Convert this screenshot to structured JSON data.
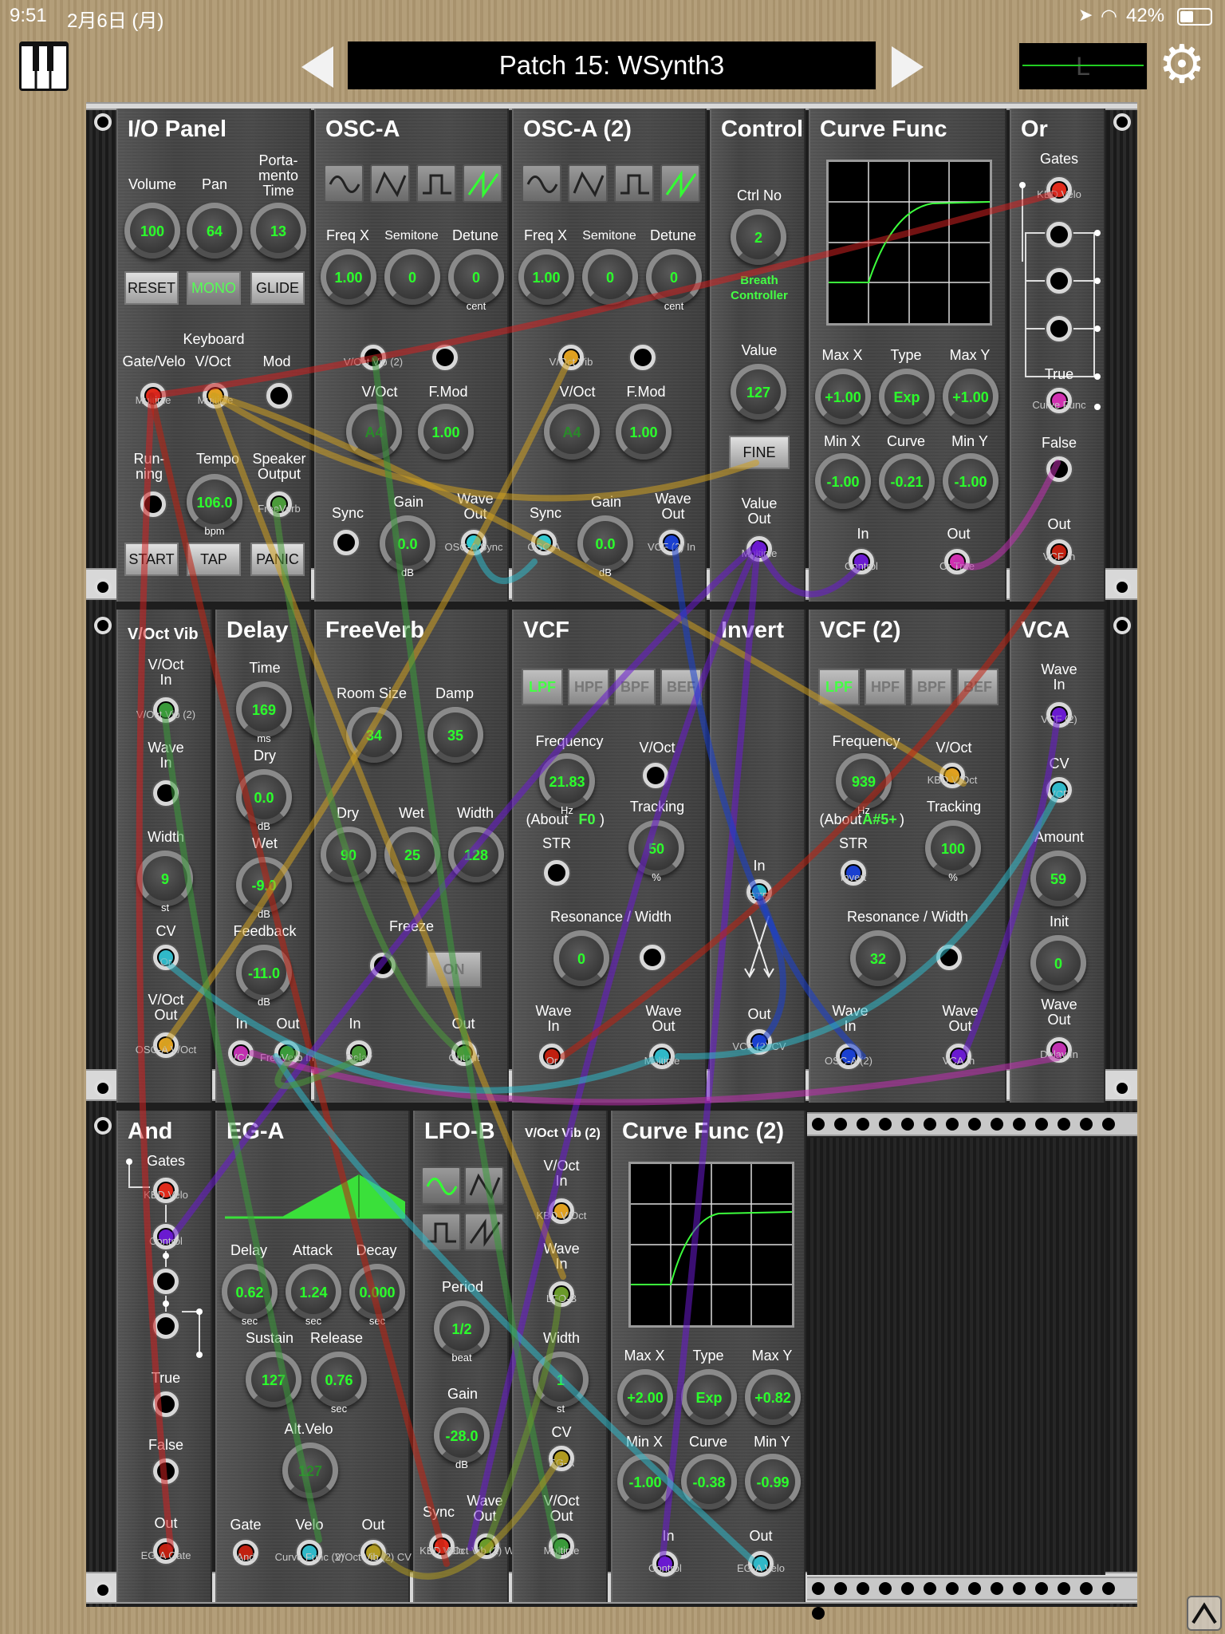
{
  "status": {
    "time": "9:51",
    "date": "2月6日 (月)",
    "battery": "42%"
  },
  "header": {
    "patch_title": "Patch 15: WSynth3",
    "meter_text": "L",
    "piano_icon": "piano-keyboard-icon",
    "settings_icon": "gear-icon",
    "prev_icon": "left-triangle-icon",
    "next_icon": "right-triangle-icon"
  },
  "colors": {
    "wood": "#b09a74",
    "panel": "#4a4a4a",
    "knob_value": "#2bff2b",
    "screen_curve": "#3cff3c"
  },
  "modules": {
    "io": {
      "title": "I/O Panel",
      "volume": "Volume",
      "pan": "Pan",
      "porta": "Porta-\nmento\nTime",
      "volume_v": "100",
      "pan_v": "64",
      "porta_v": "13",
      "reset": "RESET",
      "mono": "MONO",
      "glide": "GLIDE",
      "keyboard": "Keyboard",
      "gatevelo": "Gate/Velo",
      "voct": "V/Oct",
      "mod": "Mod",
      "gatevelo_j": "Multiple",
      "voct_j": "Multiple",
      "running": "Run-\nning",
      "tempo": "Tempo",
      "tempo_v": "106.0",
      "tempo_u": "bpm",
      "speaker": "Speaker\nOutput",
      "speaker_j": "FreeVerb",
      "start": "START",
      "tap": "TAP",
      "panic": "PANIC"
    },
    "osca": {
      "title": "OSC-A",
      "freqx": "Freq X",
      "semitone": "Semitone",
      "detune": "Detune",
      "freqx_v": "1.00",
      "semitone_v": "0",
      "detune_v": "0",
      "detune_u": "cent",
      "vibjack": "V/Oct Vib (2)",
      "voct": "V/Oct",
      "fmod": "F.Mod",
      "voct_v": "A4",
      "fmod_v": "1.00",
      "sync": "Sync",
      "gain": "Gain",
      "gain_v": "0.0",
      "gain_u": "dB",
      "waveout": "Wave\nOut",
      "waveout_j": "OSC-A Sync"
    },
    "osca2": {
      "title": "OSC-A (2)",
      "freqx": "Freq X",
      "semitone": "Semitone",
      "detune": "Detune",
      "freqx_v": "1.00",
      "semitone_v": "0",
      "detune_v": "0",
      "detune_u": "cent",
      "vibjack": "V/Oct Vib",
      "voct": "V/Oct",
      "fmod": "F.Mod",
      "voct_v": "A4",
      "fmod_v": "1.00",
      "sync": "Sync",
      "sync_j": "OSC-A",
      "gain": "Gain",
      "gain_v": "0.0",
      "gain_u": "dB",
      "waveout": "Wave\nOut",
      "waveout_j": "VCF (2) In"
    },
    "control": {
      "title": "Control",
      "ctrlno": "Ctrl No",
      "ctrlno_v": "2",
      "ctrlno_desc": "Breath\nController",
      "value": "Value",
      "value_v": "127",
      "fine": "FINE",
      "valueout": "Value\nOut",
      "valueout_j": "Multiple"
    },
    "curve": {
      "title": "Curve Func",
      "maxx": "Max X",
      "type": "Type",
      "maxy": "Max Y",
      "maxx_v": "+1.00",
      "type_v": "Exp",
      "maxy_v": "+1.00",
      "minx": "Min X",
      "curve": "Curve",
      "miny": "Min Y",
      "minx_v": "-1.00",
      "curve_v": "-0.21",
      "miny_v": "-1.00",
      "in": "In",
      "in_j": "Control",
      "out": "Out",
      "out_j": "Or True"
    },
    "or": {
      "title": "Or",
      "gates": "Gates",
      "gate1_j": "KBD Velo",
      "true": "True",
      "true_j": "Curve Func",
      "false": "False",
      "out": "Out",
      "out_j": "VCF In"
    },
    "voctvib": {
      "title": "V/Oct Vib",
      "voctin": "V/Oct\nIn",
      "voctin_j": "V/Oct Vib (2)",
      "wavein": "Wave\nIn",
      "width": "Width",
      "width_v": "9",
      "width_u": "st",
      "cv": "CV",
      "cv_j": "Or",
      "voctout": "V/Oct\nOut",
      "voctout_j": "OSC-A V/Oct"
    },
    "delay": {
      "title": "Delay",
      "time": "Time",
      "time_v": "169",
      "time_u": "ms",
      "dry": "Dry",
      "dry_v": "0.0",
      "dry_u": "dB",
      "wet": "Wet",
      "wet_v": "-9.0",
      "wet_u": "dB",
      "feedback": "Feedback",
      "feedback_v": "-11.0",
      "feedback_u": "dB",
      "in": "In",
      "in_j": "VCA",
      "out": "Out",
      "out_j": "FreeVerb In"
    },
    "freeverb": {
      "title": "FreeVerb",
      "roomsize": "Room Size",
      "damp": "Damp",
      "roomsize_v": "34",
      "damp_v": "35",
      "dry": "Dry",
      "wet": "Wet",
      "width": "Width",
      "dry_v": "90",
      "wet_v": "25",
      "width_v": "128",
      "freeze": "Freeze",
      "on": "ON",
      "in": "In",
      "in_j": "Delay",
      "out": "Out",
      "out_j": "Output"
    },
    "vcf": {
      "title": "VCF",
      "lpf": "LPF",
      "hpf": "HPF",
      "bpf": "BPF",
      "bef": "BEF",
      "frequency": "Frequency",
      "freq_v": "21.83",
      "freq_u": "Hz",
      "about": "(About",
      "note": "F0",
      "about_end": ")",
      "voct": "V/Oct",
      "tracking": "Tracking",
      "tracking_v": "50",
      "tracking_u": "%",
      "str": "STR",
      "reswidth": "Resonance / Width",
      "res_v": "0",
      "wavein": "Wave\nIn",
      "wavein_j": "Or",
      "waveout": "Wave\nOut",
      "waveout_j": "Multiple"
    },
    "invert": {
      "title": "Invert",
      "in": "In",
      "in_j": "STR",
      "out": "Out",
      "out_j": "VCF (2) CV"
    },
    "vcf2": {
      "title": "VCF (2)",
      "lpf": "LPF",
      "hpf": "HPF",
      "bpf": "BPF",
      "bef": "BEF",
      "frequency": "Frequency",
      "freq_v": "939",
      "freq_u": "Hz",
      "about": "(About",
      "note": "A#5+",
      "about_end": ")",
      "voct": "V/Oct",
      "voct_j": "KBD V/Oct",
      "tracking": "Tracking",
      "tracking_v": "100",
      "tracking_u": "%",
      "str": "STR",
      "str_j": "Invert",
      "reswidth": "Resonance / Width",
      "res_v": "32",
      "wavein": "Wave\nIn",
      "wavein_j": "OSC-A (2)",
      "waveout": "Wave\nOut",
      "waveout_j": "VCA In"
    },
    "vca": {
      "title": "VCA",
      "wavein": "Wave\nIn",
      "wavein_j": "VCF (2)",
      "cv": "CV",
      "cv_j": "VCF",
      "amount": "Amount",
      "amount_v": "59",
      "init": "Init",
      "init_v": "0",
      "waveout": "Wave\nOut",
      "waveout_j": "Delay In"
    },
    "and": {
      "title": "And",
      "gates": "Gates",
      "g1_j": "KBD Velo",
      "g2_j": "Control",
      "true": "True",
      "false": "False",
      "out": "Out",
      "out_j": "EG-A Gate"
    },
    "ega": {
      "title": "EG-A",
      "delay": "Delay",
      "attack": "Attack",
      "decay": "Decay",
      "delay_v": "0.62",
      "attack_v": "1.24",
      "decay_v": "0.000",
      "u": "sec",
      "sustain": "Sustain",
      "release": "Release",
      "sustain_v": "127",
      "release_v": "0.76",
      "altvelo": "Alt.Velo",
      "altvelo_v": "127",
      "gate": "Gate",
      "gate_j": "And",
      "velo": "Velo",
      "velo_j": "Curve Func (2)",
      "out": "Out",
      "out_j": "V/Oct Vib (2) CV"
    },
    "lfob": {
      "title": "LFO-B",
      "period": "Period",
      "period_v": "1/2",
      "period_u": "beat",
      "gain": "Gain",
      "gain_v": "-28.0",
      "gain_u": "dB",
      "sync": "Sync",
      "sync_j": "KBD Velo",
      "waveout": "Wave\nOut",
      "waveout_j": "V/Oct Vib (2) Wave In"
    },
    "voctvib2": {
      "title": "V/Oct Vib (2)",
      "voctin": "V/Oct\nIn",
      "voctin_j": "KBD V/Oct",
      "wavein": "Wave\nIn",
      "wavein_j": "LFO-B",
      "width": "Width",
      "width_v": "1",
      "width_u": "st",
      "cv": "CV",
      "cv_j": "EG-A",
      "voctout": "V/Oct\nOut",
      "voctout_j": "Multiple"
    },
    "curve2": {
      "title": "Curve Func (2)",
      "maxx": "Max X",
      "type": "Type",
      "maxy": "Max Y",
      "maxx_v": "+2.00",
      "type_v": "Exp",
      "maxy_v": "+0.82",
      "minx": "Min X",
      "curve": "Curve",
      "miny": "Min Y",
      "minx_v": "-1.00",
      "curve_v": "-0.38",
      "miny_v": "-0.99",
      "in": "In",
      "in_j": "Control",
      "out": "Out",
      "out_j": "EG-A Velo"
    }
  }
}
